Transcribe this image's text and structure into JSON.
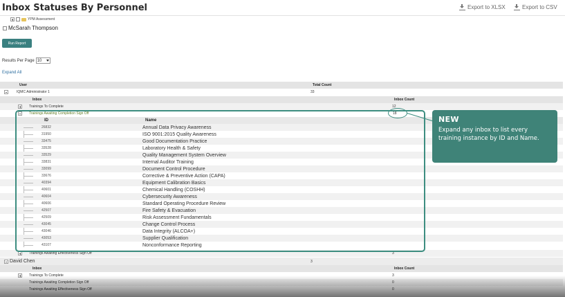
{
  "header": {
    "title": "Inbox Statuses By Personnel",
    "export_xlsx": "Export to XLSX",
    "export_csv": "Export to CSV"
  },
  "tree": {
    "top_item": "YPM Assessment",
    "selected_user": "McSarah Thompson"
  },
  "controls": {
    "run_report": "Run Report",
    "results_per_page_label": "Results Per Page",
    "results_per_page_value": "10",
    "expand_all": "Expand All"
  },
  "report": {
    "col_user": "User",
    "col_total": "Total Count",
    "user1": {
      "name": "IQMC Administrator 1",
      "total": "33"
    },
    "col_inbox": "Inbox",
    "col_inbox_count": "Inbox Count",
    "inboxes1": [
      {
        "name": "Trainings To Complete",
        "count": "12"
      },
      {
        "name": "Trainings Awaiting Completion Sign Off",
        "count": "18"
      },
      {
        "name": "Trainings Awaiting Effectiveness Sign Off",
        "count": "3"
      }
    ],
    "detail_col_id": "ID",
    "detail_col_name": "Name",
    "trainings": [
      {
        "id": "26832",
        "name": "Annual Data Privacy Awareness"
      },
      {
        "id": "31950",
        "name": "ISO 9001:2015 Quality Awareness"
      },
      {
        "id": "33475",
        "name": "Good Documentation Practice"
      },
      {
        "id": "33528",
        "name": "Laboratory Health & Safety"
      },
      {
        "id": "33529",
        "name": "Quality Management System Overview"
      },
      {
        "id": "33831",
        "name": "Internal Auditor Training"
      },
      {
        "id": "33099",
        "name": "Document Control Procedure"
      },
      {
        "id": "33676",
        "name": "Corrective & Preventive Action (CAPA)"
      },
      {
        "id": "40394",
        "name": "Equipment Calibration Basics"
      },
      {
        "id": "40601",
        "name": "Chemical Handling (COSHH)"
      },
      {
        "id": "40604",
        "name": "Cybersecurity Awareness"
      },
      {
        "id": "40606",
        "name": "Standard Operating Procedure Review"
      },
      {
        "id": "42507",
        "name": "Fire Safety & Evacuation"
      },
      {
        "id": "42509",
        "name": "Risk Assessment Fundamentals"
      },
      {
        "id": "43045",
        "name": "Change Control Process"
      },
      {
        "id": "43046",
        "name": "Data Integrity (ALCOA+)"
      },
      {
        "id": "43053",
        "name": "Supplier Qualification"
      },
      {
        "id": "43107",
        "name": "Nonconformance Reporting"
      }
    ],
    "user2": {
      "name": "David Chen",
      "total": "3"
    },
    "inboxes2": [
      {
        "name": "Trainings To Complete",
        "count": "3"
      },
      {
        "name": "Trainings Awaiting Completion Sign Off",
        "count": "0"
      },
      {
        "name": "Trainings Awaiting Effectiveness Sign Off",
        "count": "0"
      }
    ]
  },
  "callout": {
    "title": "NEW",
    "body": "Expand any inbox to list every training instance by ID and Name."
  },
  "colors": {
    "accent": "#3f8378",
    "button": "#3a8080",
    "link": "#2d6ea0"
  }
}
